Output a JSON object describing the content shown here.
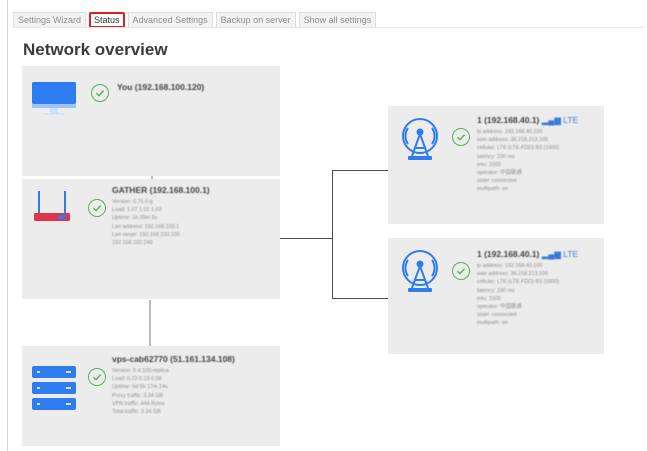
{
  "tabs": [
    {
      "label": "Settings Wizard",
      "active": false
    },
    {
      "label": "Status",
      "active": true
    },
    {
      "label": "Advanced Settings",
      "active": false
    },
    {
      "label": "Backup on server",
      "active": false
    },
    {
      "label": "Show all settings",
      "active": false
    }
  ],
  "page_title": "Network overview",
  "nodes": {
    "you": {
      "title": "You (192.168.100.120)",
      "icon": "monitor-icon",
      "status": "ok"
    },
    "gateway": {
      "title": "GATHER (192.168.100.1)",
      "icon": "router-icon",
      "status": "ok",
      "info": [
        "Version: 0.75.0-g",
        "Load: 1.07 1.01 1.03",
        "Uptime: 1h 39m 5s",
        "Lan address: 192.168.100.1",
        "Lan range: 192.168.100.100 -",
        "192.168.100.249"
      ]
    },
    "server": {
      "title": "vps-cab62770 (51.161.134.108)",
      "icon": "server-icon",
      "status": "ok",
      "info": [
        "Version: 0.4.100-replica",
        "Load: 0.23 0.19 0.08",
        "Uptime: 5d 5h 17m 14s",
        "Proxy traffic: 3.34 GB",
        "VPN traffic: 444 Bytes",
        "Total traffic: 3.34 GB"
      ]
    },
    "modem1": {
      "title": "1 (192.168.40.1)",
      "network": "LTE",
      "icon": "cell-tower-icon",
      "status": "ok",
      "info": [
        "ip address: 192.168.40.100",
        "wan address: 36.218.213.105",
        "cellular: LTE (LTE-FDD) B3 (1800)",
        "latency: 230 ms",
        "mtu: 1500",
        "operator: 中国联通",
        "state: connected",
        "multipath: on"
      ]
    },
    "modem2": {
      "title": "1 (192.168.40.1)",
      "network": "LTE",
      "icon": "cell-tower-icon",
      "status": "ok",
      "info": [
        "ip address: 192.168.40.100",
        "wan address: 36.218.213.105",
        "cellular: LTE (LTE-FDD) B3 (1800)",
        "latency: 230 ms",
        "mtu: 1500",
        "operator: 中国联通",
        "state: connected",
        "multipath: on"
      ]
    }
  },
  "colors": {
    "accent_green": "#57b25a",
    "active_tab_border": "#e02020",
    "device_blue": "#2f7cf0",
    "router_red": "#e0344a",
    "card_bg": "#ececec"
  }
}
